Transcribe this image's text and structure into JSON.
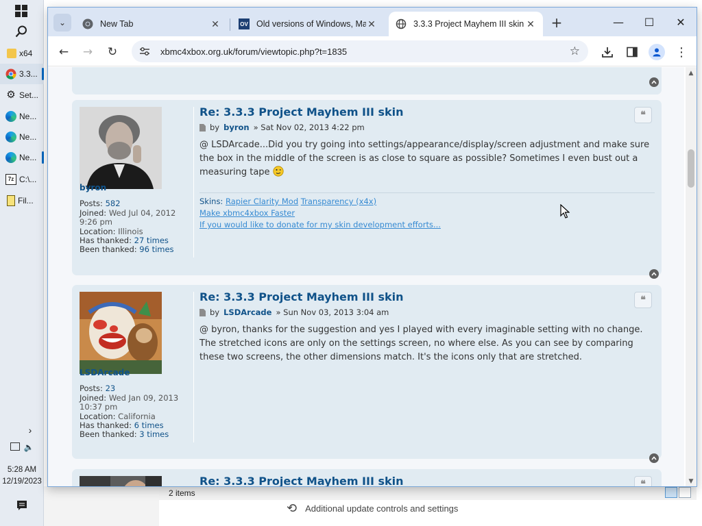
{
  "taskbar": {
    "apps": [
      {
        "label": "x64",
        "icon": "folder-icon"
      },
      {
        "label": "3.3...",
        "icon": "chrome-icon"
      },
      {
        "label": "Set...",
        "icon": "gear-icon"
      },
      {
        "label": "Ne...",
        "icon": "edge-icon"
      },
      {
        "label": "Ne...",
        "icon": "edge-icon"
      },
      {
        "label": "Ne...",
        "icon": "edge-icon"
      },
      {
        "label": "C:\\...",
        "icon": "7zip-icon"
      },
      {
        "label": "Fil...",
        "icon": "file-icon"
      }
    ],
    "clock_time": "5:28 AM",
    "clock_date": "12/19/2023"
  },
  "background_window": {
    "status_items": "2 items",
    "update_text": "Additional update controls and settings"
  },
  "browser": {
    "tabs": [
      {
        "title": "New Tab",
        "icon": "chrome-icon"
      },
      {
        "title": "Old versions of Windows, Mac",
        "icon": "oldversion-icon",
        "favicon_text": "OV"
      },
      {
        "title": "3.3.3 Project Mayhem III skin",
        "icon": "globe-icon"
      }
    ],
    "url": "xbmc4xbox.org.uk/forum/viewtopic.php?t=1835"
  },
  "posts": [
    {
      "title": "Re: 3.3.3 Project Mayhem III skin",
      "by": "by",
      "author": "byron",
      "date": "» Sat Nov 02, 2013 4:22 pm",
      "body": "@ LSDArcade...Did you try going into settings/appearance/display/screen adjustment and make sure the box in the middle of the screen is as close to square as possible? Sometimes I even bust out a measuring tape",
      "profile": {
        "username": "byron",
        "posts_label": "Posts:",
        "posts": "582",
        "joined_label": "Joined:",
        "joined": "Wed Jul 04, 2012 9:26 pm",
        "location_label": "Location:",
        "location": "Illinois",
        "thanked_label": "Has thanked:",
        "thanked": "27 times",
        "been_thanked_label": "Been thanked:",
        "been_thanked": "96 times"
      },
      "signature": {
        "skins_label": "Skins:",
        "link1": "Rapier Clarity Mod",
        "link2": "Transparency (x4x)",
        "link3": "Make xbmc4xbox Faster",
        "link4": "If you would like to donate for my skin development efforts..."
      }
    },
    {
      "title": "Re: 3.3.3 Project Mayhem III skin",
      "by": "by",
      "author": "LSDArcade",
      "date": "» Sun Nov 03, 2013 3:04 am",
      "body": "@ byron, thanks for the suggestion and yes I played with every imaginable setting with no change. The stretched icons are only on the settings screen, no where else. As you can see by comparing these two screens, the other dimensions match. It's the icons only that are stretched.",
      "profile": {
        "username": "LSDArcade",
        "posts_label": "Posts:",
        "posts": "23",
        "joined_label": "Joined:",
        "joined": "Wed Jan 09, 2013 10:37 pm",
        "location_label": "Location:",
        "location": "California",
        "thanked_label": "Has thanked:",
        "thanked": "6 times",
        "been_thanked_label": "Been thanked:",
        "been_thanked": "3 times"
      }
    },
    {
      "title": "Re: 3.3.3 Project Mayhem III skin"
    }
  ]
}
